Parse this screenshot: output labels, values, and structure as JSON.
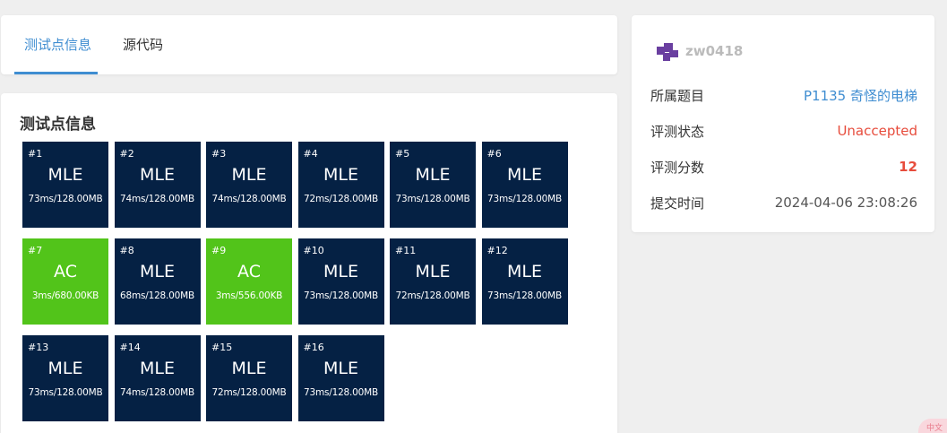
{
  "tabs": [
    {
      "label": "测试点信息",
      "active": true
    },
    {
      "label": "源代码",
      "active": false
    }
  ],
  "section_title": "测试点信息",
  "colors": {
    "accent": "#3f8dd1",
    "mle": "#052144",
    "ac": "#52c41a",
    "error": "#e74c3c"
  },
  "testcases": [
    {
      "num": "#1",
      "status": "MLE",
      "meta": "73ms/128.00MB"
    },
    {
      "num": "#2",
      "status": "MLE",
      "meta": "74ms/128.00MB"
    },
    {
      "num": "#3",
      "status": "MLE",
      "meta": "74ms/128.00MB"
    },
    {
      "num": "#4",
      "status": "MLE",
      "meta": "72ms/128.00MB"
    },
    {
      "num": "#5",
      "status": "MLE",
      "meta": "73ms/128.00MB"
    },
    {
      "num": "#6",
      "status": "MLE",
      "meta": "73ms/128.00MB"
    },
    {
      "num": "#7",
      "status": "AC",
      "meta": "3ms/680.00KB"
    },
    {
      "num": "#8",
      "status": "MLE",
      "meta": "68ms/128.00MB"
    },
    {
      "num": "#9",
      "status": "AC",
      "meta": "3ms/556.00KB"
    },
    {
      "num": "#10",
      "status": "MLE",
      "meta": "73ms/128.00MB"
    },
    {
      "num": "#11",
      "status": "MLE",
      "meta": "72ms/128.00MB"
    },
    {
      "num": "#12",
      "status": "MLE",
      "meta": "73ms/128.00MB"
    },
    {
      "num": "#13",
      "status": "MLE",
      "meta": "73ms/128.00MB"
    },
    {
      "num": "#14",
      "status": "MLE",
      "meta": "74ms/128.00MB"
    },
    {
      "num": "#15",
      "status": "MLE",
      "meta": "72ms/128.00MB"
    },
    {
      "num": "#16",
      "status": "MLE",
      "meta": "73ms/128.00MB"
    }
  ],
  "info": {
    "username": "zw0418",
    "avatar_icon": "purple-puzzle-avatar-icon",
    "rows": [
      {
        "label": "所属题目",
        "value": "P1135 奇怪的电梯"
      },
      {
        "label": "评测状态",
        "value": "Unaccepted"
      },
      {
        "label": "评测分数",
        "value": "12"
      },
      {
        "label": "提交时间",
        "value": "2024-04-06 23:08:26"
      }
    ]
  },
  "corner_badge": "中文"
}
